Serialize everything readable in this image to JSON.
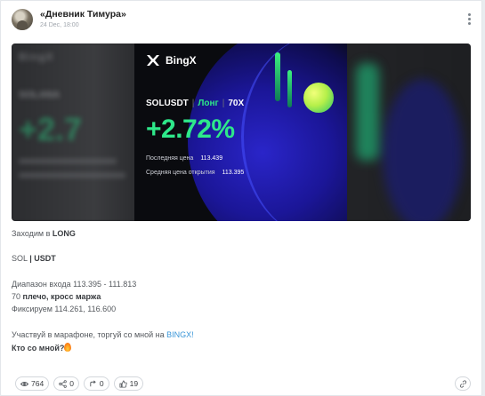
{
  "post": {
    "channel_name": "«Дневник Тимура»",
    "date": "24 Dec, 18:00",
    "menu_icon": "more-vertical-icon"
  },
  "media": {
    "blur_left": {
      "logo": "BingX",
      "title": "SOLANA",
      "percent": "+2.7"
    },
    "card": {
      "logo_text": "BingX",
      "pair": "SOLUSDT",
      "side": "Лонг",
      "leverage": "70X",
      "percent": "+2.72%",
      "last_price_label": "Последняя цена",
      "last_price": "113.439",
      "avg_open_label": "Средняя цена открытия",
      "avg_open": "113.395",
      "accent_color": "#2ee88a",
      "background_color": "#0a0b0f"
    }
  },
  "body": {
    "line1_pre": "Заходим в ",
    "line1_bold": "LONG",
    "line2_pre": "SOL ",
    "line2_bold": "| USDT",
    "line3": "Диапазон входа 113.395 - 111.813",
    "line4_pre": "70 ",
    "line4_bold": "плечо, кросс маржа",
    "line5": "Фиксируем 114.261, 116.600",
    "line6_pre": "Участвуй в марафоне, торгуй со мной на ",
    "line6_link": "BINGX!",
    "line7_bold": "Кто со мной?",
    "link_color": "#3a96d8"
  },
  "actions": {
    "views": "764",
    "shares": "0",
    "reposts": "0",
    "likes": "19",
    "views_icon": "eye-icon",
    "shares_icon": "share-icon",
    "reposts_icon": "repost-icon",
    "likes_icon": "thumbs-up-icon",
    "link_icon": "link-icon"
  }
}
